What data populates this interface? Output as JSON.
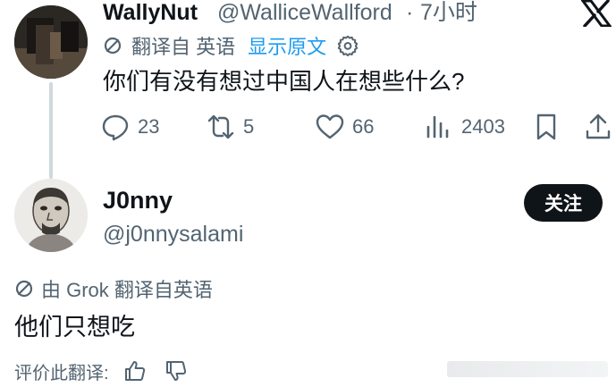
{
  "tweet": {
    "author_name": "WallyNut",
    "author_handle": "@WalliceWallford",
    "separator": "·",
    "time": "7小时",
    "translate_label": "翻译自 英语",
    "show_original": "显示原文",
    "text": "你们有没有想过中国人在想些什么?",
    "counts": {
      "replies": "23",
      "reposts": "5",
      "likes": "66",
      "views": "2403"
    }
  },
  "reply": {
    "author_name": "J0nny",
    "author_handle": "@j0nnysalami",
    "follow_label": "关注",
    "translate_label": "由 Grok 翻译自英语",
    "text": "他们只想吃",
    "rate_label": "评价此翻译:"
  },
  "colors": {
    "text": "#0f1419",
    "secondary": "#536471",
    "link": "#1d9bf0",
    "thread_line": "#cfd9de",
    "button_bg": "#0f1419"
  },
  "icons": [
    "x-logo-icon",
    "translate-icon",
    "gear-icon",
    "reply-icon",
    "repost-icon",
    "like-icon",
    "views-icon",
    "bookmark-icon",
    "share-icon",
    "thumbs-up-icon",
    "thumbs-down-icon"
  ]
}
